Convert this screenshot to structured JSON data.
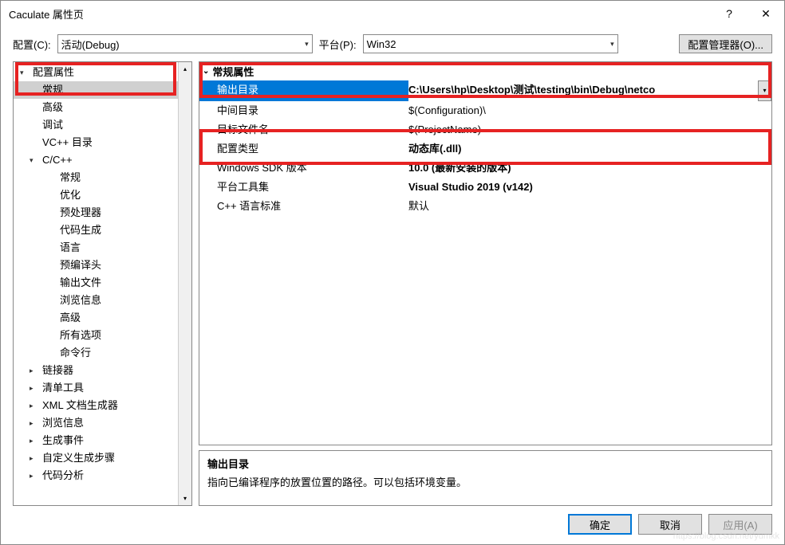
{
  "window": {
    "title": "Caculate 属性页"
  },
  "titlebarButtons": {
    "help": "?",
    "close": "✕"
  },
  "configRow": {
    "configLabel": "配置(C):",
    "configValue": "活动(Debug)",
    "platformLabel": "平台(P):",
    "platformValue": "Win32",
    "managerButton": "配置管理器(O)..."
  },
  "tree": {
    "root": {
      "label": "配置属性"
    },
    "general": {
      "label": "常规"
    },
    "advanced": {
      "label": "高级"
    },
    "debug": {
      "label": "调试"
    },
    "vcdirs": {
      "label": "VC++ 目录"
    },
    "ccpp": {
      "label": "C/C++"
    },
    "ccpp_general": {
      "label": "常规"
    },
    "ccpp_opt": {
      "label": "优化"
    },
    "ccpp_pre": {
      "label": "预处理器"
    },
    "ccpp_codegen": {
      "label": "代码生成"
    },
    "ccpp_lang": {
      "label": "语言"
    },
    "ccpp_pch": {
      "label": "预编译头"
    },
    "ccpp_out": {
      "label": "输出文件"
    },
    "ccpp_browse": {
      "label": "浏览信息"
    },
    "ccpp_adv": {
      "label": "高级"
    },
    "ccpp_all": {
      "label": "所有选项"
    },
    "ccpp_cmd": {
      "label": "命令行"
    },
    "linker": {
      "label": "链接器"
    },
    "manifest": {
      "label": "清单工具"
    },
    "xmldoc": {
      "label": "XML 文档生成器"
    },
    "browseinfo": {
      "label": "浏览信息"
    },
    "buildevents": {
      "label": "生成事件"
    },
    "custombuild": {
      "label": "自定义生成步骤"
    },
    "codeanalysis": {
      "label": "代码分析"
    }
  },
  "propGroup": {
    "header": "常规属性"
  },
  "props": {
    "outdir": {
      "name": "输出目录",
      "value": "C:\\Users\\hp\\Desktop\\测试\\testing\\bin\\Debug\\netco"
    },
    "intdir": {
      "name": "中间目录",
      "value": "$(Configuration)\\"
    },
    "targetname": {
      "name": "目标文件名",
      "value": "$(ProjectName)"
    },
    "configtype": {
      "name": "配置类型",
      "value": "动态库(.dll)"
    },
    "sdkver": {
      "name": "Windows SDK 版本",
      "value": "10.0 (最新安装的版本)"
    },
    "toolset": {
      "name": "平台工具集",
      "value": "Visual Studio 2019 (v142)"
    },
    "cppstd": {
      "name": "C++ 语言标准",
      "value": "默认"
    }
  },
  "description": {
    "title": "输出目录",
    "text": "指向已编译程序的放置位置的路径。可以包括环境变量。"
  },
  "buttons": {
    "ok": "确定",
    "cancel": "取消",
    "apply": "应用(A)"
  },
  "watermark": "https://blog.csdn.net/yumkk"
}
